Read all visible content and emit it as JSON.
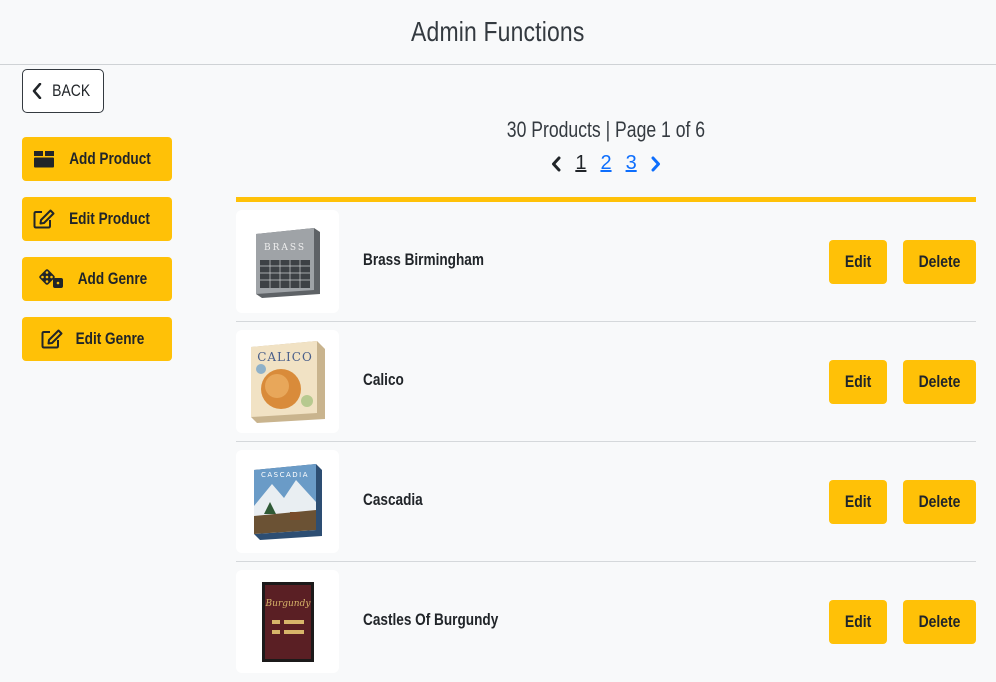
{
  "header": {
    "title": "Admin Functions"
  },
  "nav": {
    "back_label": "BACK"
  },
  "sidebar": {
    "buttons": [
      {
        "label": "Add Product",
        "icon": "box-icon"
      },
      {
        "label": "Edit Product",
        "icon": "edit-icon"
      },
      {
        "label": "Add Genre",
        "icon": "dice-icon"
      },
      {
        "label": "Edit Genre",
        "icon": "edit-icon"
      }
    ]
  },
  "summary": {
    "text": "30 Products | Page 1 of 6"
  },
  "pagination": {
    "prev_icon": "chevron-left-icon",
    "next_icon": "chevron-right-icon",
    "pages": [
      "1",
      "2",
      "3"
    ],
    "current": "1"
  },
  "products": [
    {
      "name": "Brass Birmingham",
      "edit_label": "Edit",
      "delete_label": "Delete",
      "cover_text": "BRASS",
      "cover_color": "#7d8186"
    },
    {
      "name": "Calico",
      "edit_label": "Edit",
      "delete_label": "Delete",
      "cover_text": "CALICO",
      "cover_color": "#e8c79a"
    },
    {
      "name": "Cascadia",
      "edit_label": "Edit",
      "delete_label": "Delete",
      "cover_text": "CASCADIA",
      "cover_color": "#3f6e9e"
    },
    {
      "name": "Castles Of Burgundy",
      "edit_label": "Edit",
      "delete_label": "Delete",
      "cover_text": "Burgundy",
      "cover_color": "#5a1f24"
    }
  ],
  "colors": {
    "accent": "#ffc107",
    "link": "#0d6efd",
    "background": "#f8f9fa"
  }
}
